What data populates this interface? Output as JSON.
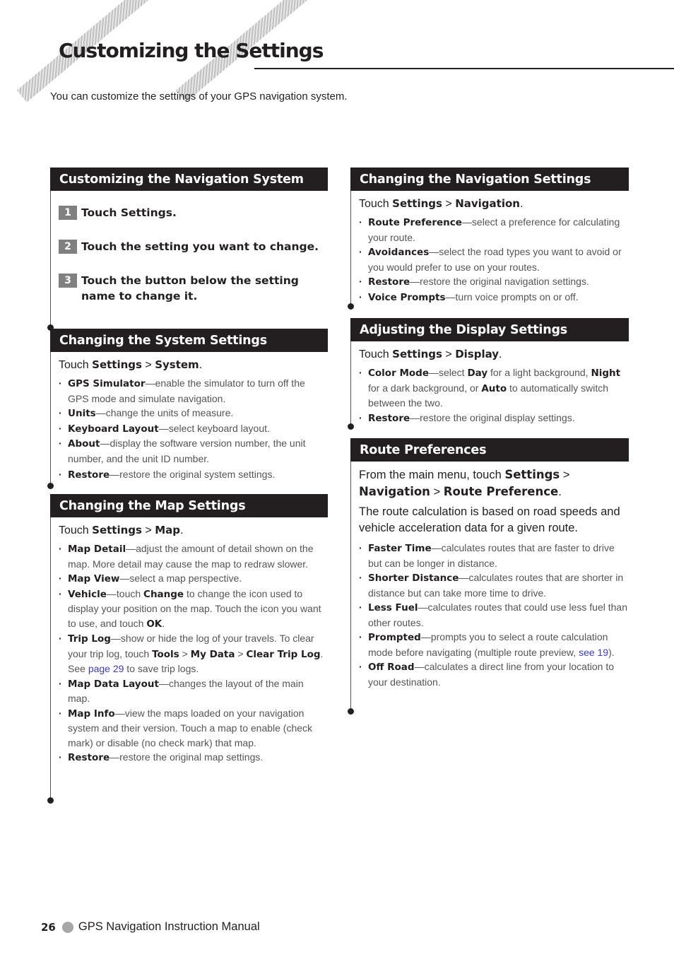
{
  "page": {
    "title": "Customizing the Settings",
    "intro": "You can customize the settings of your GPS navigation system."
  },
  "sections": {
    "customizing_nav": {
      "heading": "Customizing the Navigation System",
      "steps": [
        {
          "num": "1",
          "text": "Touch Settings."
        },
        {
          "num": "2",
          "text": "Touch the setting you want to change."
        },
        {
          "num": "3",
          "text": "Touch the button below the setting name to change it."
        }
      ]
    },
    "system": {
      "heading": "Changing the System Settings",
      "touch_prefix": "Touch ",
      "path1": "Settings",
      "sep": " > ",
      "path2": "System",
      "end": ".",
      "items": [
        {
          "term": "GPS Simulator",
          "desc": "—enable the simulator to turn off the GPS mode and simulate navigation."
        },
        {
          "term": "Units",
          "desc": "—change the units of measure."
        },
        {
          "term": "Keyboard Layout",
          "desc": "—select keyboard layout."
        },
        {
          "term": "About",
          "desc": "—display the software version number, the unit number, and the unit ID number."
        },
        {
          "term": "Restore",
          "desc": "—restore the original system settings."
        }
      ]
    },
    "map": {
      "heading": "Changing the Map Settings",
      "touch_prefix": "Touch ",
      "path1": "Settings",
      "sep": " > ",
      "path2": "Map",
      "end": ".",
      "items": [
        {
          "term": "Map Detail",
          "desc": "—adjust the amount of detail shown on the map. More detail may cause the map to redraw slower."
        },
        {
          "term": "Map View",
          "desc": "—select a map perspective."
        },
        {
          "term": "Vehicle",
          "desc1": "—touch ",
          "bold1": "Change",
          "desc2": " to change the icon used to display your position on the map. Touch the icon you want to use, and touch ",
          "bold2": "OK",
          "desc3": "."
        },
        {
          "term": "Trip Log",
          "desc1": "—show or hide the log of your travels. To clear your trip log, touch ",
          "bold1": "Tools",
          "sep1": " > ",
          "bold2": "My Data",
          "sep2": " > ",
          "bold3": "Clear Trip Log",
          "desc2": ". See ",
          "link": "page 29",
          "desc3": " to save trip logs."
        },
        {
          "term": "Map Data Layout",
          "desc": "—changes the layout of the main map."
        },
        {
          "term": "Map Info",
          "desc": "—view the maps loaded on your navigation system and their version. Touch a map to enable (check mark) or disable (no check mark) that map."
        },
        {
          "term": "Restore",
          "desc": "—restore the original map settings."
        }
      ]
    },
    "navigation": {
      "heading": "Changing the Navigation Settings",
      "touch_prefix": "Touch ",
      "path1": "Settings",
      "sep": " > ",
      "path2": "Navigation",
      "end": ".",
      "items": [
        {
          "term": "Route Preference",
          "desc": "—select a preference for calculating your route."
        },
        {
          "term": "Avoidances",
          "desc": "—select the road types you want to avoid or you would prefer to use on your routes."
        },
        {
          "term": "Restore",
          "desc": "—restore the original navigation settings."
        },
        {
          "term": "Voice Prompts",
          "desc": "—turn voice prompts on or off."
        }
      ]
    },
    "display": {
      "heading": "Adjusting the Display Settings",
      "touch_prefix": "Touch ",
      "path1": "Settings",
      "sep": " > ",
      "path2": "Display",
      "end": ".",
      "items": [
        {
          "term": "Color Mode",
          "desc1": "—select ",
          "bold1": "Day",
          "desc2": " for a light background, ",
          "bold2": "Night",
          "desc3": " for a dark background, or ",
          "bold3": "Auto",
          "desc4": " to automatically switch between the two."
        },
        {
          "term": "Restore",
          "desc": "—restore the original display settings."
        }
      ]
    },
    "route": {
      "heading": "Route Preferences",
      "p1_prefix": "From the main menu, touch ",
      "p1_b1": "Settings",
      "sep": " > ",
      "p1_b2": "Navigation",
      "p1_b3": "Route Preference",
      "end": ".",
      "p2": "The route calculation is based on road speeds and vehicle acceleration data for a given route.",
      "items": [
        {
          "term": "Faster Time",
          "desc": "—calculates routes that are faster to drive but can be longer in distance."
        },
        {
          "term": "Shorter Distance",
          "desc": "—calculates routes that are shorter in distance but can take more time to drive."
        },
        {
          "term": "Less Fuel",
          "desc": "—calculates routes that could use less fuel than other routes."
        },
        {
          "term": "Prompted",
          "desc1": "—prompts you to select a route calculation mode before navigating (multiple route preview, ",
          "link": "see 19",
          "desc2": ")."
        },
        {
          "term": "Off Road",
          "desc": "—calculates a direct line from your location to your destination."
        }
      ]
    }
  },
  "footer": {
    "page_number": "26",
    "manual_title": "GPS Navigation Instruction Manual"
  },
  "colors": {
    "heading_bg": "#231f20",
    "link": "#3b3bd4",
    "step_badge": "#808080"
  }
}
